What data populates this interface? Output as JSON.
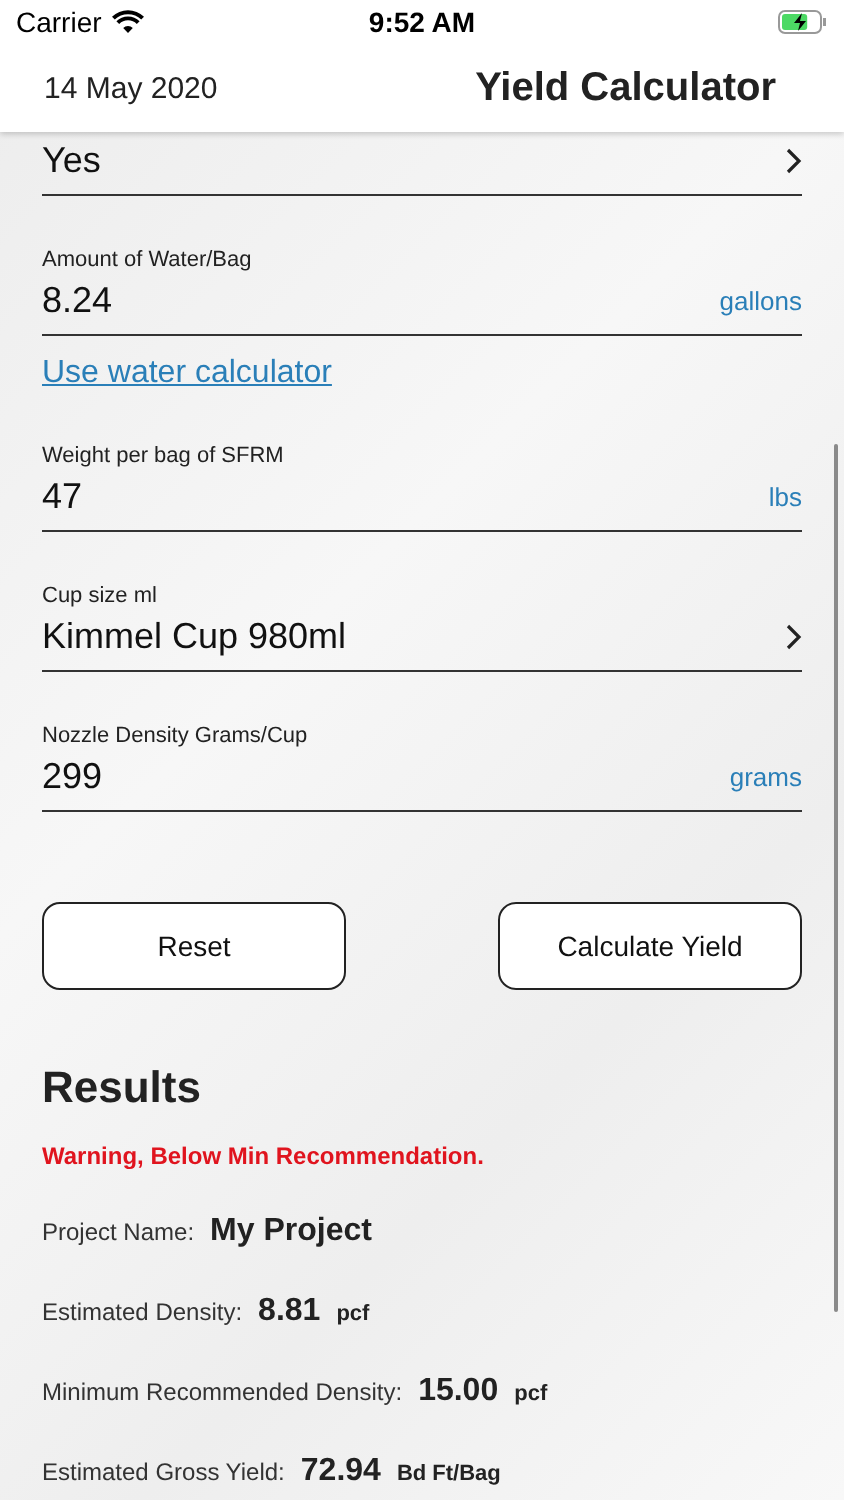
{
  "status_bar": {
    "carrier": "Carrier",
    "time": "9:52 AM"
  },
  "header": {
    "date": "14 May 2020",
    "title": "Yield Calculator"
  },
  "fields": [
    {
      "kind": "select",
      "value": "Yes"
    },
    {
      "kind": "input",
      "label": "Amount of Water/Bag",
      "value": "8.24",
      "unit": "gallons"
    },
    {
      "kind": "link",
      "label": "Use water calculator"
    },
    {
      "kind": "input",
      "label": "Weight per bag of SFRM",
      "value": "47",
      "unit": "lbs"
    },
    {
      "kind": "select",
      "label": "Cup size ml",
      "value": "Kimmel Cup 980ml"
    },
    {
      "kind": "input",
      "label": "Nozzle Density Grams/Cup",
      "value": "299",
      "unit": "grams"
    }
  ],
  "buttons": [
    "Reset",
    "Calculate Yield"
  ],
  "results": {
    "title": "Results",
    "warning": "Warning, Below Min Recommendation.",
    "rows": [
      {
        "label": "Project Name:",
        "value": "My Project"
      },
      {
        "label": "Estimated Density:",
        "value": "8.81",
        "unit": "pcf"
      },
      {
        "label": "Minimum Recommended Density:",
        "value": "15.00",
        "unit": "pcf"
      },
      {
        "label": "Estimated Gross Yield:",
        "value": "72.94",
        "unit": "Bd Ft/Bag"
      }
    ]
  }
}
